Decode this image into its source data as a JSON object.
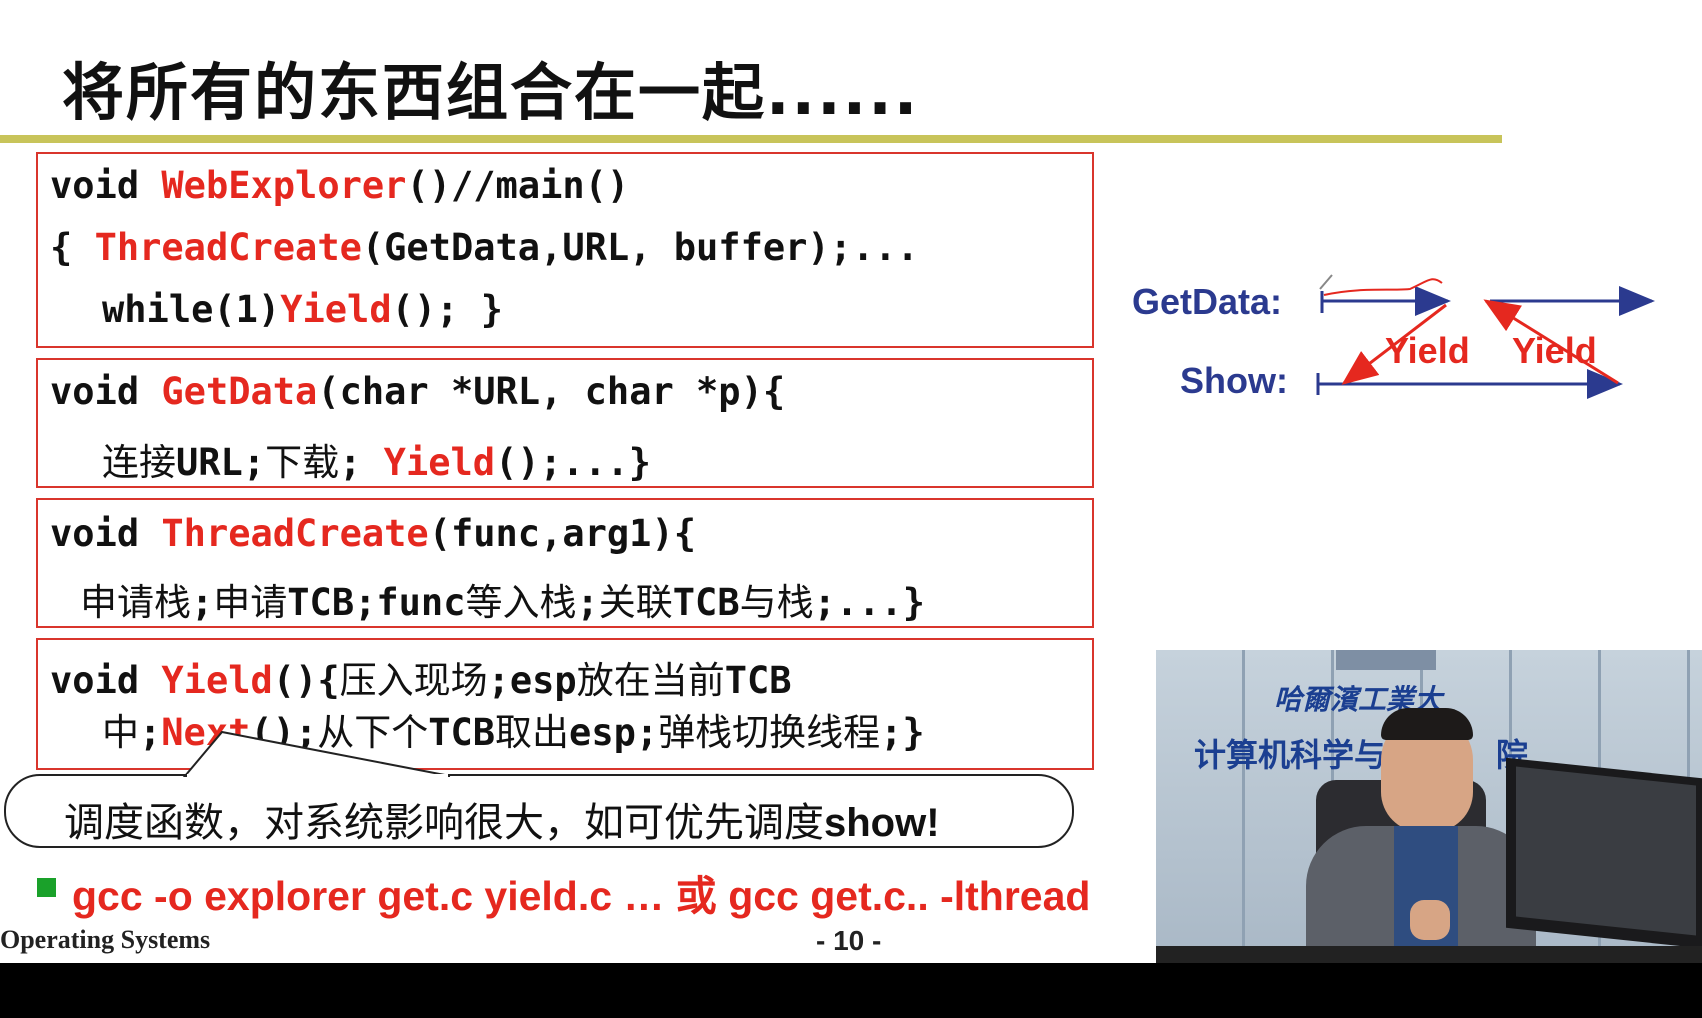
{
  "slide": {
    "title": "将所有的东西组合在一起......",
    "accent_color": "#c8c45a",
    "code_red": "#e5281f",
    "box1": {
      "l1_kw": "void ",
      "l1_fn": "WebExplorer",
      "l1_rest": "()//main()",
      "l2_open": "{ ",
      "l2_fn": "ThreadCreate",
      "l2_rest": "(GetData,URL, buffer);...",
      "l3_kw": "while(1)",
      "l3_fn": "Yield",
      "l3_rest": "(); }"
    },
    "box2": {
      "l1_kw": "void ",
      "l1_fn": "GetData",
      "l1_rest": "(char *URL, char *p){",
      "l2_cn1": "连接",
      "l2_a": "URL;",
      "l2_cn2": "下载",
      "l2_b": "; ",
      "l2_fn": "Yield",
      "l2_rest": "();...}"
    },
    "box3": {
      "l1_kw": "void ",
      "l1_fn": "ThreadCreate",
      "l1_rest": "(func,arg1){",
      "l2_cn1": "申请栈",
      "l2_a": ";",
      "l2_cn2": "申请",
      "l2_b": "TCB;func",
      "l2_cn3": "等入栈",
      "l2_c": ";",
      "l2_cn4": "关联",
      "l2_d": "TCB",
      "l2_cn5": "与栈",
      "l2_e": ";...}"
    },
    "box4": {
      "l1_kw": "void ",
      "l1_fn": "Yield",
      "l1_rest": "(){",
      "l1_cn1": "压入现场",
      "l1_a": ";esp",
      "l1_cn2": "放在当前",
      "l1_b": "TCB",
      "l2_cn1": "中",
      "l2_a": ";",
      "l2_fn": "Next",
      "l2_b": "();",
      "l2_cn2": "从下个",
      "l2_c": "TCB",
      "l2_cn3": "取出",
      "l2_d": "esp;",
      "l2_cn4": "弹栈切换线程",
      "l2_e": ";}"
    },
    "callout": {
      "text": "调度函数，对系统影响很大，如可优先调度",
      "bold": "show!"
    },
    "bullet_color": "#1aa12a",
    "gcc_line": "gcc -o explorer get.c yield.c … 或 gcc get.c.. -lthread",
    "footer": {
      "course": "Operating Systems",
      "page": "- 10 -"
    }
  },
  "diagram": {
    "getdata_label": "GetData:",
    "show_label": "Show:",
    "yield_label_1": "Yield",
    "yield_label_2": "Yield",
    "arrow_blue": "#2b3a8f",
    "arrow_red": "#e5281f"
  },
  "video": {
    "wall_line1": "哈爾濱工業大",
    "wall_line2": "计算机科学与技",
    "wall_line2_end": "院"
  }
}
